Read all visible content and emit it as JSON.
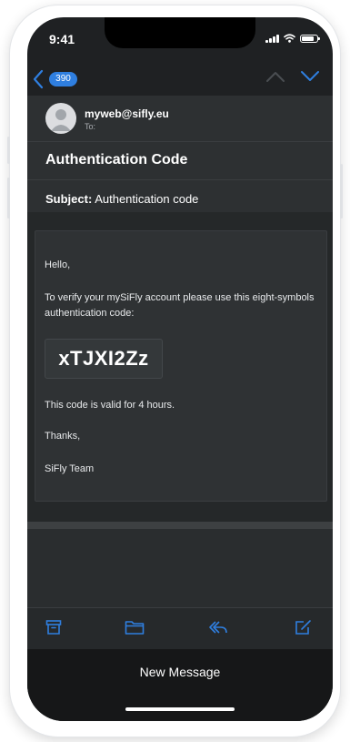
{
  "status_bar": {
    "time": "9:41",
    "icons": [
      "cellular-signal-icon",
      "wifi-icon",
      "battery-icon"
    ]
  },
  "nav": {
    "back_icon": "chevron-left-icon",
    "inbox_count": "390",
    "prev_icon": "chevron-up-icon",
    "next_icon": "chevron-down-icon"
  },
  "header": {
    "sender": "myweb@sifly.eu",
    "to_label": "To:",
    "title": "Authentication Code",
    "subject_label": "Subject:",
    "subject_value": "Authentication code"
  },
  "email": {
    "greeting": "Hello,",
    "instruction": "To verify your mySiFly account please use this eight-symbols authentication code:",
    "code": "xTJXI2Zz",
    "validity": "This code is valid for 4 hours.",
    "thanks": "Thanks,",
    "signature": "SiFly Team"
  },
  "toolbar": {
    "icons": [
      "archive-icon",
      "folder-icon",
      "reply-icon",
      "compose-icon"
    ]
  },
  "sheet": {
    "label": "New Message"
  },
  "colors": {
    "accent": "#2f7fe0",
    "background": "#1f2123",
    "card": "#2f3234"
  }
}
